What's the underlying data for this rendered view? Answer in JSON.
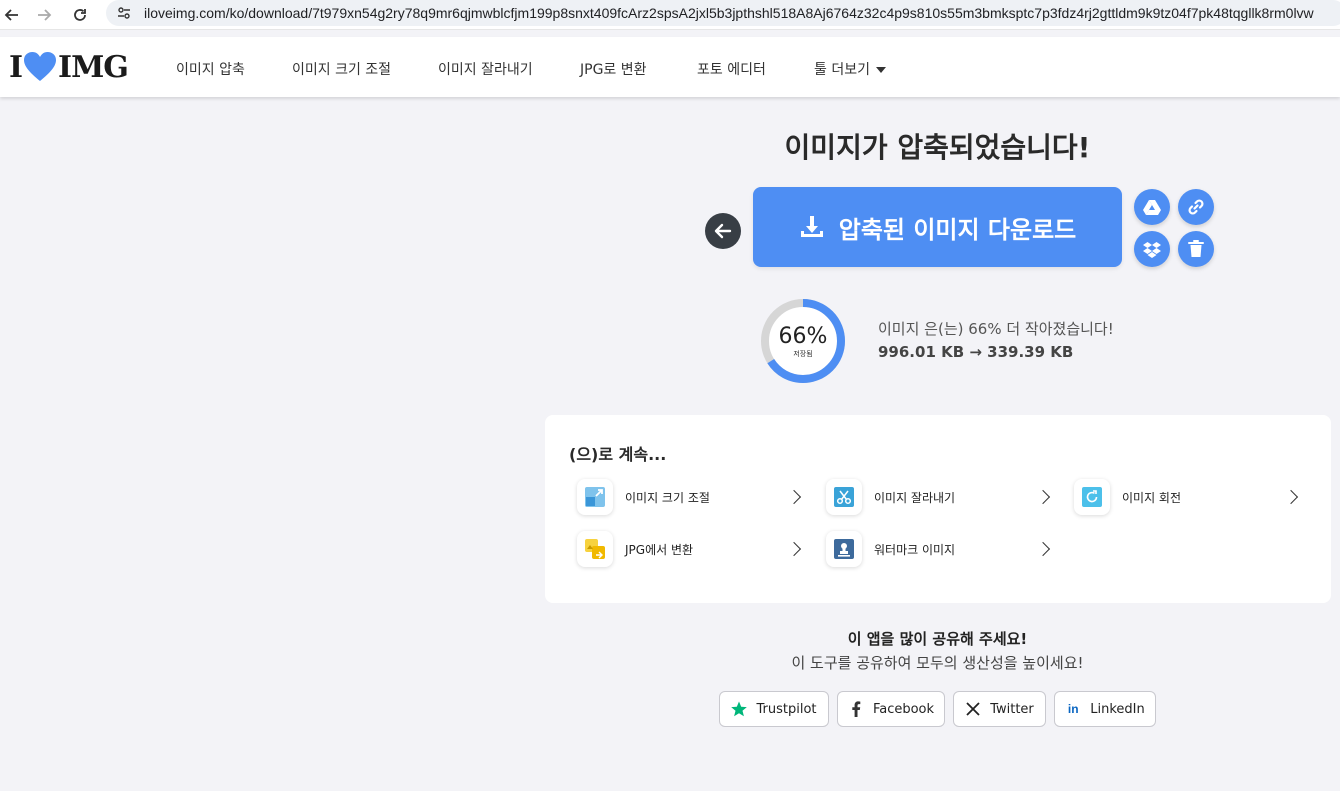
{
  "browser": {
    "url": "iloveimg.com/ko/download/7t979xn54g2ry78q9mr6qjmwblcfjm199p8snxt409fcArz2spsA2jxl5b3jpthshl518A8Aj6764z32c4p9s810s55m3bmksptc7p3fdz4rj2gttldm9k9tz04f7pk48tqgllk8rm0lvw"
  },
  "header": {
    "logo_left": "I",
    "logo_right": "IMG",
    "nav": [
      "이미지 압축",
      "이미지 크기 조절",
      "이미지 잘라내기",
      "JPG로 변환",
      "포토 에디터",
      "툴 더보기"
    ]
  },
  "main": {
    "title": "이미지가 압축되었습니다!",
    "download_label": "압축된 이미지 다운로드",
    "gauge_percent": "66%",
    "gauge_value": 66,
    "gauge_sub": "저장됨",
    "stat_line": "이미지 은(는) 66% 더 작아졌습니다!",
    "stat_sizes": "996.01 KB → 339.39 KB"
  },
  "continue": {
    "title": "(으)로 계속...",
    "tools": [
      {
        "label": "이미지 크기 조절",
        "icon": "resize-icon"
      },
      {
        "label": "이미지 잘라내기",
        "icon": "crop-icon"
      },
      {
        "label": "이미지 회전",
        "icon": "rotate-icon"
      },
      {
        "label": "JPG에서 변환",
        "icon": "convert-from-jpg-icon"
      },
      {
        "label": "워터마크 이미지",
        "icon": "watermark-icon"
      }
    ]
  },
  "share": {
    "title": "이 앱을 많이 공유해 주세요!",
    "subtitle": "이 도구를 공유하여 모두의 생산성을 높이세요!",
    "buttons": [
      "Trustpilot",
      "Facebook",
      "Twitter",
      "LinkedIn"
    ]
  },
  "colors": {
    "accent": "#4e8ef3",
    "dark": "#383e45",
    "background": "#f3f3f7",
    "trustpilot_green": "#00b67a",
    "gauge_track": "#d6d6d6"
  }
}
